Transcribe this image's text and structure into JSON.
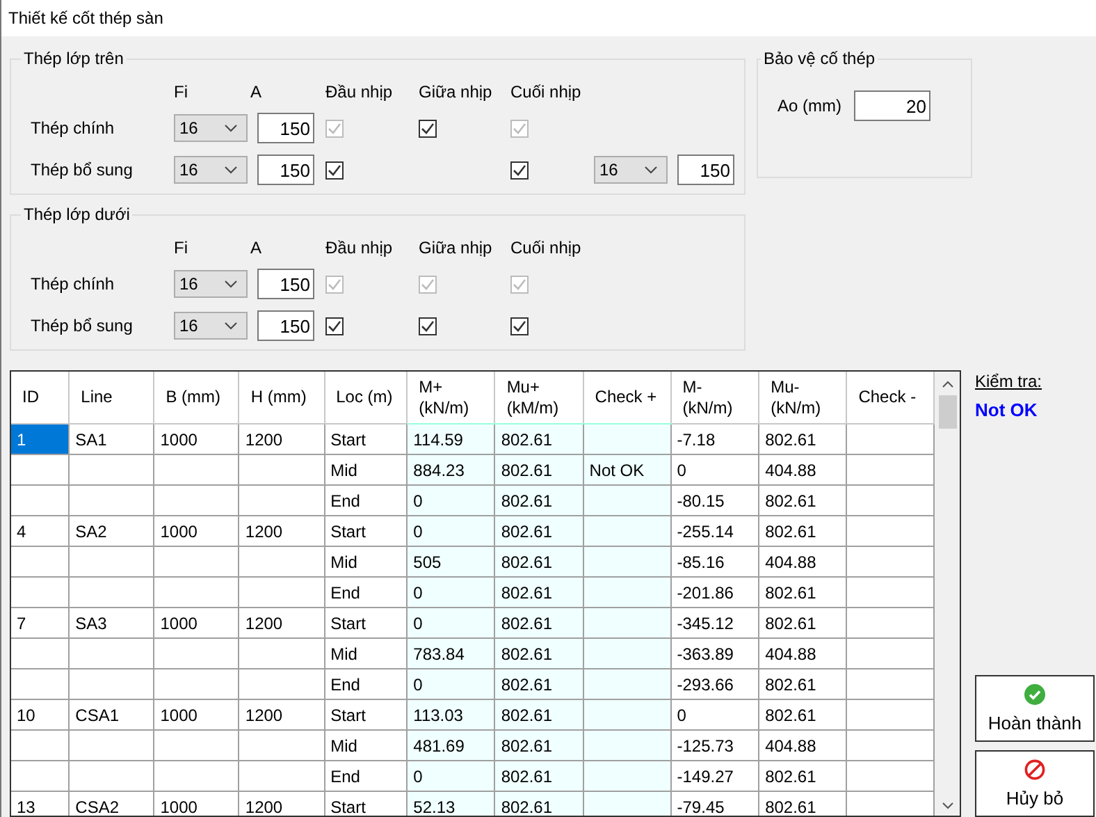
{
  "window": {
    "title": "Thiết kế cốt thép sàn"
  },
  "layers": [
    {
      "title": "Thép lớp trên",
      "headers": [
        "Fi",
        "A",
        "Đầu nhịp",
        "Giữa nhịp",
        "Cuối nhịp"
      ],
      "rows": [
        {
          "label": "Thép chính",
          "fi": "16",
          "a": "150",
          "checks": [
            {
              "kind": "checkbox",
              "checked": true,
              "disabled": true
            },
            {
              "kind": "checkbox",
              "checked": true,
              "disabled": false
            },
            {
              "kind": "checkbox",
              "checked": true,
              "disabled": true
            }
          ]
        },
        {
          "label": "Thép bổ sung",
          "fi": "16",
          "a": "150",
          "checks": [
            {
              "kind": "checkbox",
              "checked": true,
              "disabled": false
            },
            {
              "kind": "empty"
            },
            {
              "kind": "checkbox",
              "checked": true,
              "disabled": false
            }
          ],
          "extra": {
            "fi": "16",
            "a": "150"
          }
        }
      ]
    },
    {
      "title": "Thép lớp dưới",
      "headers": [
        "Fi",
        "A",
        "Đầu nhịp",
        "Giữa nhịp",
        "Cuối nhịp"
      ],
      "rows": [
        {
          "label": "Thép chính",
          "fi": "16",
          "a": "150",
          "checks": [
            {
              "kind": "checkbox",
              "checked": true,
              "disabled": true
            },
            {
              "kind": "checkbox",
              "checked": true,
              "disabled": true
            },
            {
              "kind": "checkbox",
              "checked": true,
              "disabled": true
            }
          ]
        },
        {
          "label": "Thép bổ sung",
          "fi": "16",
          "a": "150",
          "checks": [
            {
              "kind": "checkbox",
              "checked": true,
              "disabled": false
            },
            {
              "kind": "checkbox",
              "checked": true,
              "disabled": false
            },
            {
              "kind": "checkbox",
              "checked": true,
              "disabled": false
            }
          ]
        }
      ]
    }
  ],
  "cover": {
    "title": "Bảo vệ cố thép",
    "label": "Ao (mm)",
    "value": "20"
  },
  "table": {
    "columns": [
      {
        "label": "ID",
        "tinted": false
      },
      {
        "label": "Line",
        "tinted": false
      },
      {
        "label": "B (mm)",
        "tinted": false
      },
      {
        "label": "H (mm)",
        "tinted": false
      },
      {
        "label": "Loc (m)",
        "tinted": false
      },
      {
        "label": "M+\n(kN/m)",
        "tinted": true
      },
      {
        "label": "Mu+\n(kM/m)",
        "tinted": true
      },
      {
        "label": "Check +",
        "tinted": true
      },
      {
        "label": "M-\n(kN/m)",
        "tinted": false
      },
      {
        "label": "Mu-\n(kN/m)",
        "tinted": false
      },
      {
        "label": "Check -",
        "tinted": false
      }
    ],
    "groups": [
      {
        "selected": true,
        "id": "1",
        "line": "SA1",
        "b": "1000",
        "h": "1200",
        "points": [
          {
            "loc": "Start",
            "m_plus": "114.59",
            "mu_plus": "802.61",
            "m_minus": "-7.18",
            "mu_minus": "802.61"
          },
          {
            "loc": "Mid",
            "m_plus": "884.23",
            "mu_plus": "802.61",
            "check_plus": "Not OK",
            "m_minus": "0",
            "mu_minus": "404.88"
          },
          {
            "loc": "End",
            "m_plus": "0",
            "mu_plus": "802.61",
            "m_minus": "-80.15",
            "mu_minus": "802.61"
          }
        ]
      },
      {
        "selected": false,
        "id": "4",
        "line": "SA2",
        "b": "1000",
        "h": "1200",
        "points": [
          {
            "loc": "Start",
            "m_plus": "0",
            "mu_plus": "802.61",
            "m_minus": "-255.14",
            "mu_minus": "802.61"
          },
          {
            "loc": "Mid",
            "m_plus": "505",
            "mu_plus": "802.61",
            "m_minus": "-85.16",
            "mu_minus": "404.88"
          },
          {
            "loc": "End",
            "m_plus": "0",
            "mu_plus": "802.61",
            "m_minus": "-201.86",
            "mu_minus": "802.61"
          }
        ]
      },
      {
        "selected": false,
        "id": "7",
        "line": "SA3",
        "b": "1000",
        "h": "1200",
        "points": [
          {
            "loc": "Start",
            "m_plus": "0",
            "mu_plus": "802.61",
            "m_minus": "-345.12",
            "mu_minus": "802.61"
          },
          {
            "loc": "Mid",
            "m_plus": "783.84",
            "mu_plus": "802.61",
            "m_minus": "-363.89",
            "mu_minus": "404.88"
          },
          {
            "loc": "End",
            "m_plus": "0",
            "mu_plus": "802.61",
            "m_minus": "-293.66",
            "mu_minus": "802.61"
          }
        ]
      },
      {
        "selected": false,
        "id": "10",
        "line": "CSA1",
        "b": "1000",
        "h": "1200",
        "points": [
          {
            "loc": "Start",
            "m_plus": "113.03",
            "mu_plus": "802.61",
            "m_minus": "0",
            "mu_minus": "802.61"
          },
          {
            "loc": "Mid",
            "m_plus": "481.69",
            "mu_plus": "802.61",
            "m_minus": "-125.73",
            "mu_minus": "404.88"
          },
          {
            "loc": "End",
            "m_plus": "0",
            "mu_plus": "802.61",
            "m_minus": "-149.27",
            "mu_minus": "802.61"
          }
        ]
      },
      {
        "selected": false,
        "id": "13",
        "line": "CSA2",
        "b": "1000",
        "h": "1200",
        "points": [
          {
            "loc": "Start",
            "m_plus": "52.13",
            "mu_plus": "802.61",
            "m_minus": "-79.45",
            "mu_minus": "802.61"
          }
        ]
      }
    ]
  },
  "check": {
    "label": "Kiểm tra:",
    "result": "Not OK"
  },
  "buttons": [
    {
      "kind": "ok",
      "label": "Hoàn thành"
    },
    {
      "kind": "cancel",
      "label": "Hủy bỏ"
    }
  ]
}
